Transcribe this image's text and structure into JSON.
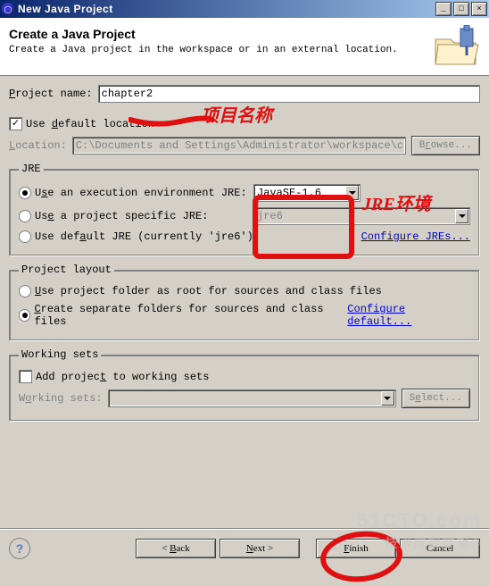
{
  "window": {
    "title": "New Java Project",
    "min": "_",
    "max": "□",
    "close": "×"
  },
  "banner": {
    "title": "Create a Java Project",
    "subtitle": "Create a Java project in the workspace or in an external location."
  },
  "form": {
    "projectNameLabel": "Project name:",
    "projectNameValue": "chapter2",
    "useDefaultLabel": "Use default location",
    "locationLabel": "Location:",
    "locationValue": "C:\\Documents and Settings\\Administrator\\workspace\\chapter",
    "browse": "Browse..."
  },
  "jre": {
    "legend": "JRE",
    "opt1": "Use an execution environment JRE:",
    "opt1Value": "JavaSE-1.6",
    "opt2": "Use a project specific JRE:",
    "opt2Value": "jre6",
    "opt3": "Use default JRE (currently 'jre6')",
    "configure": "Configure JREs..."
  },
  "layout": {
    "legend": "Project layout",
    "opt1": "Use project folder as root for sources and class files",
    "opt2": "Create separate folders for sources and class files",
    "configure": "Configure default..."
  },
  "ws": {
    "legend": "Working sets",
    "add": "Add project to working sets",
    "label": "Working sets:",
    "select": "Select..."
  },
  "footer": {
    "back": "< Back",
    "next": "Next >",
    "finish": "Finish",
    "cancel": "Cancel",
    "help": "?"
  },
  "annotations": {
    "projectName": "项目名称",
    "jreEnv": "JRE环境"
  },
  "watermarks": {
    "w1": "51CTO.com",
    "w2": "技术成就梦想®"
  }
}
